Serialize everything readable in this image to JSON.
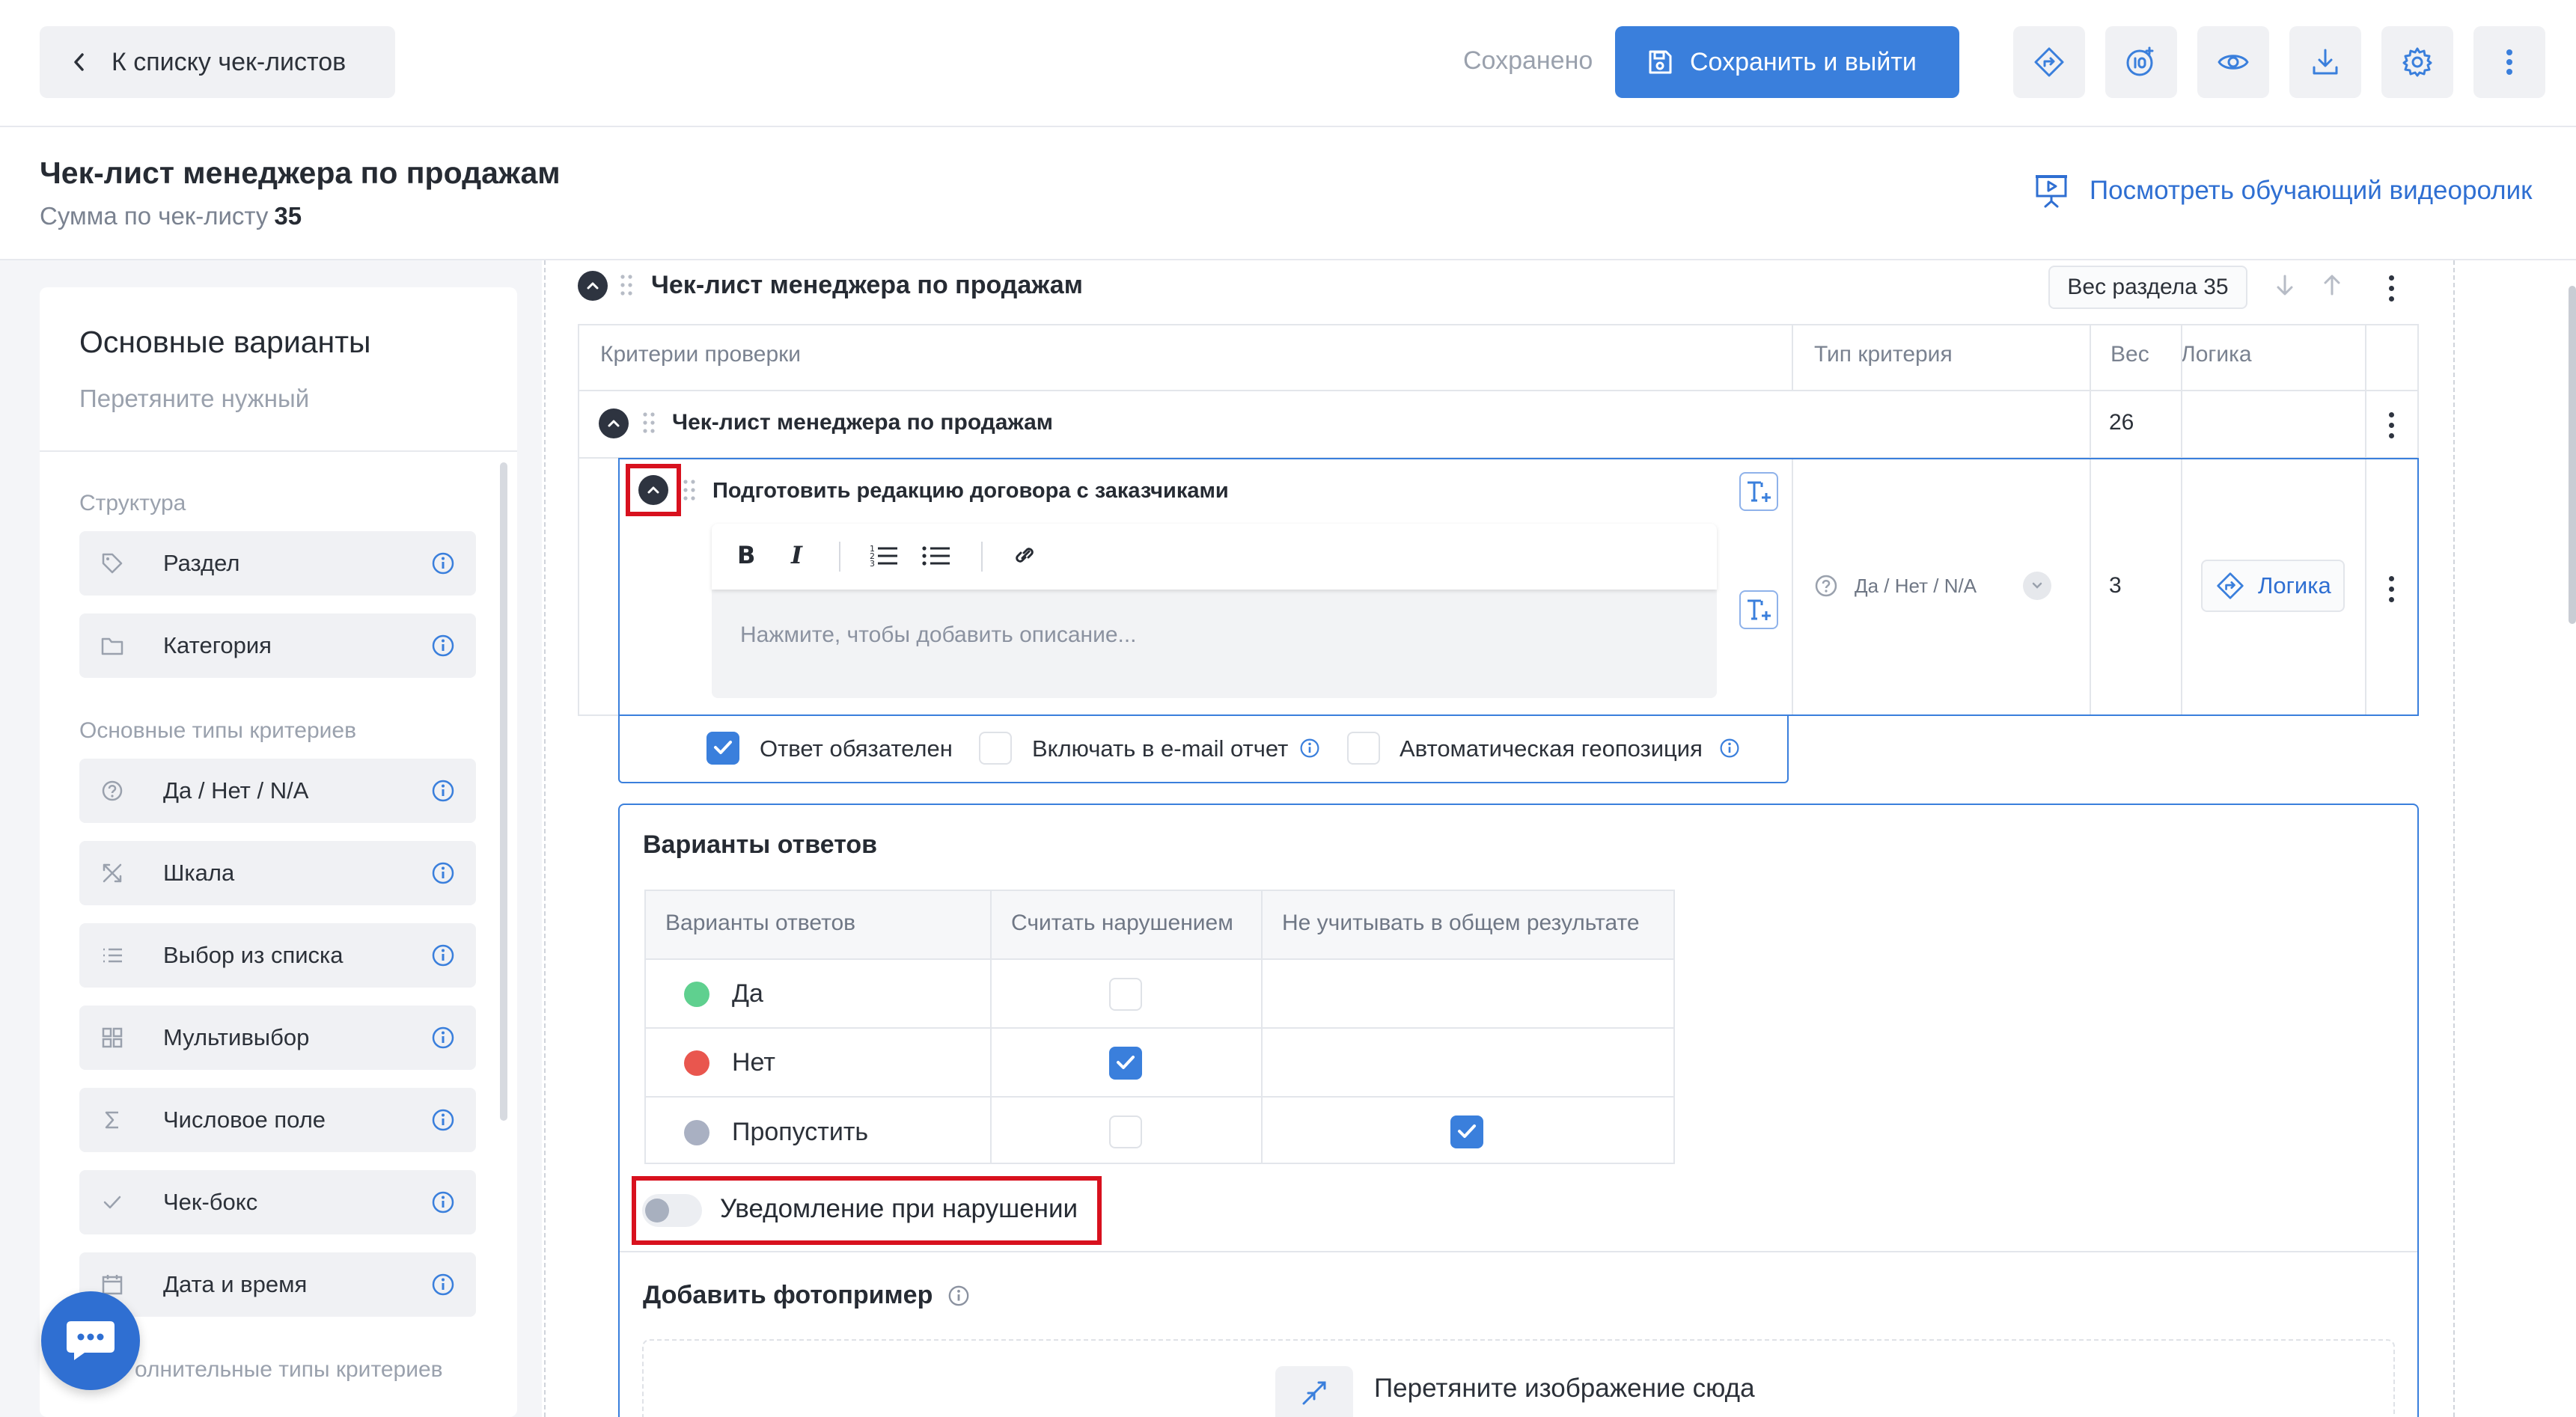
{
  "header": {
    "back_label": "К списку чек-листов",
    "saved_status": "Сохранено",
    "save_exit_label": "Сохранить и выйти",
    "icons": [
      "logic-icon",
      "score-icon",
      "eye-icon",
      "download-icon",
      "gear-icon",
      "more-vertical-icon"
    ]
  },
  "page": {
    "title": "Чек-лист менеджера по продажам",
    "sum_label": "Сумма по чек-листу",
    "sum_value": "35",
    "video_link": "Посмотреть обучающий видеоролик"
  },
  "palette": {
    "title": "Основные варианты",
    "hint": "Перетяните нужный",
    "structure_label": "Структура",
    "structure_items": [
      {
        "label": "Раздел",
        "icon": "tag-icon"
      },
      {
        "label": "Категория",
        "icon": "folder-icon"
      }
    ],
    "basic_label": "Основные типы критериев",
    "basic_items": [
      {
        "label": "Да / Нет / N/A",
        "icon": "question-circle-icon"
      },
      {
        "label": "Шкала",
        "icon": "scale-icon"
      },
      {
        "label": "Выбор из списка",
        "icon": "list-icon"
      },
      {
        "label": "Мультивыбор",
        "icon": "grid-icon"
      },
      {
        "label": "Числовое поле",
        "icon": "sigma-icon"
      },
      {
        "label": "Чек-бокс",
        "icon": "check-icon"
      },
      {
        "label": "Дата и время",
        "icon": "calendar-icon"
      }
    ],
    "extra_label": "олнительные типы критериев"
  },
  "section": {
    "title": "Чек-лист менеджера по продажам",
    "weight_label": "Вес раздела 35",
    "columns": [
      "Критерии проверки",
      "Тип критерия",
      "Вес",
      "Логика"
    ],
    "category": {
      "title": "Чек-лист менеджера по продажам",
      "weight": "26"
    },
    "criterion": {
      "title": "Подготовить редакцию договора с заказчиками",
      "description_placeholder": "Нажмите, чтобы добавить описание...",
      "type": "Да / Нет / N/A",
      "weight": "3",
      "logic_label": "Логика",
      "options": [
        {
          "label": "Ответ обязателен",
          "checked": true
        },
        {
          "label": "Включать в e-mail отчет",
          "checked": false
        },
        {
          "label": "Автоматическая геопозиция",
          "checked": false
        }
      ]
    }
  },
  "answers": {
    "title": "Варианты ответов",
    "columns": [
      "Варианты ответов",
      "Считать нарушением",
      "Не учитывать в общем результате"
    ],
    "rows": [
      {
        "label": "Да",
        "color": "#5fd08f",
        "violation": false,
        "exclude": null
      },
      {
        "label": "Нет",
        "color": "#e9564e",
        "violation": true,
        "exclude": null
      },
      {
        "label": "Пропустить",
        "color": "#a9b0c2",
        "violation": false,
        "exclude": true
      }
    ],
    "notification_label": "Уведомление при нарушении",
    "notification_on": false
  },
  "photo": {
    "title": "Добавить фотопример",
    "drop_text": "Перетяните изображение сюда"
  },
  "colors": {
    "accent": "#3a7fdc",
    "highlight": "#d8111e"
  }
}
